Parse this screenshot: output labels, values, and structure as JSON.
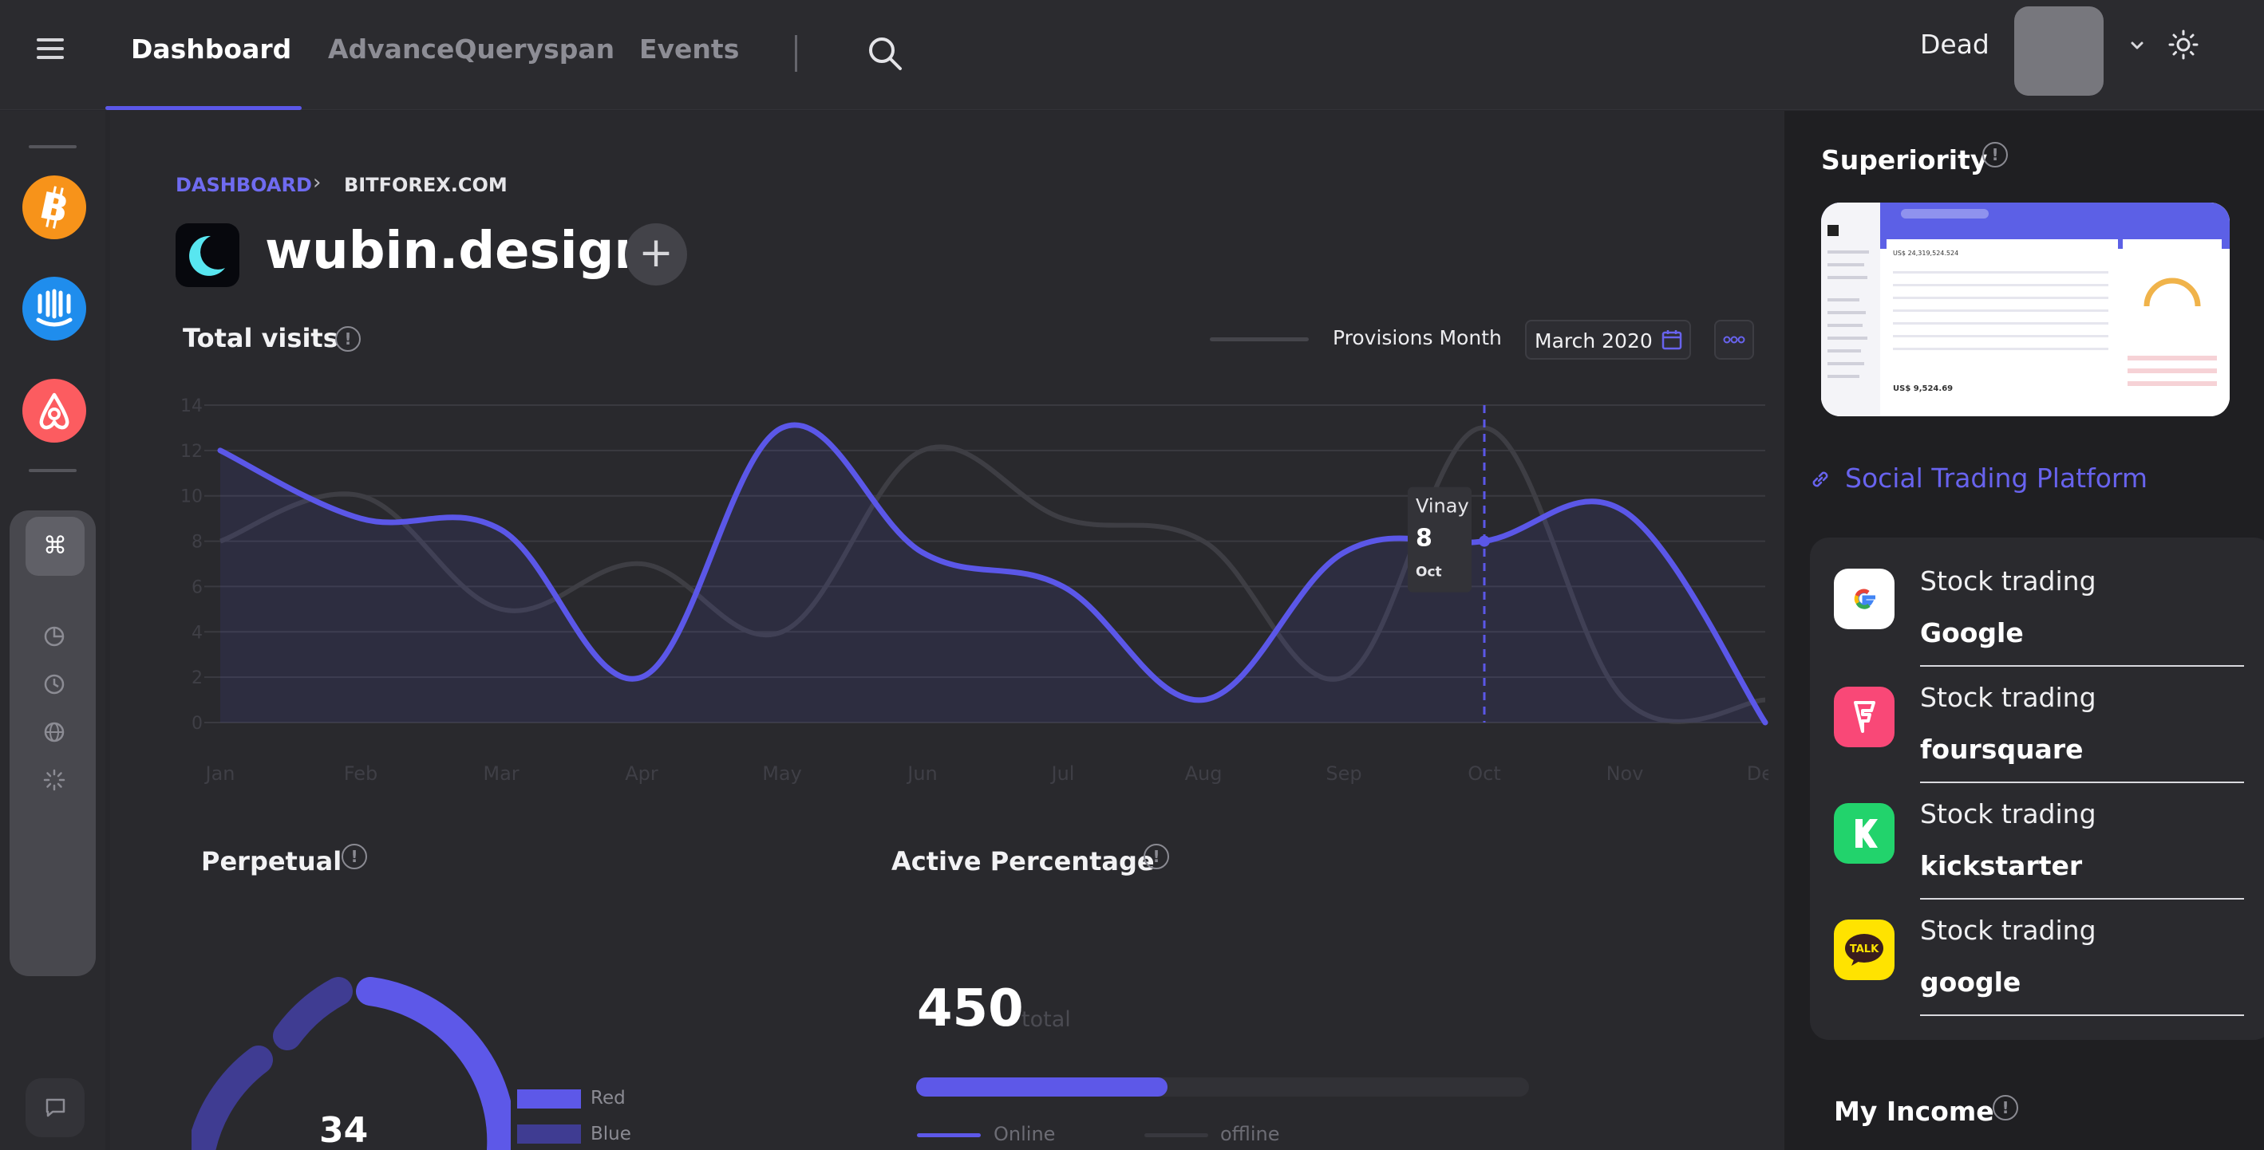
{
  "nav": {
    "tabs": [
      "Dashboard",
      "AdvanceQueryspan",
      "Events"
    ],
    "active_tab": "Dashboard",
    "user_name": "Dead"
  },
  "breadcrumb": [
    "DASHBOARD",
    "BITFOREX.COM"
  ],
  "site": {
    "title": "wubin.design",
    "add_symbol": "+"
  },
  "visits": {
    "title": "Total visits",
    "info_symbol": "!",
    "legend_label": "Provisions Month",
    "date_value": "March 2020",
    "tooltip": {
      "name": "Vinay",
      "value": "8",
      "month": "Oct"
    }
  },
  "chart_data": {
    "type": "line",
    "categories": [
      "Jan",
      "Feb",
      "Mar",
      "Apr",
      "May",
      "Jun",
      "Jul",
      "Aug",
      "Sep",
      "Oct",
      "Nov",
      "Dec"
    ],
    "ylim": [
      0,
      14
    ],
    "yticks": [
      0,
      2,
      4,
      6,
      8,
      10,
      12,
      14
    ],
    "grid": true,
    "series": [
      {
        "name": "Vinay",
        "color": "#5b57e8",
        "values": [
          12,
          9,
          8.5,
          2,
          13,
          7.5,
          6,
          1,
          7.5,
          8,
          9.3,
          0
        ]
      },
      {
        "color": "#3e3e44",
        "values": [
          8,
          10,
          5,
          7,
          4,
          12,
          9,
          8,
          2,
          13,
          1,
          1
        ]
      }
    ]
  },
  "perpetual": {
    "title": "Perpetual",
    "center_value": "34",
    "legend": [
      {
        "label": "Red",
        "color": "#5d58e8"
      },
      {
        "label": "Blue",
        "color": "#3f3c92"
      }
    ]
  },
  "active_percentage": {
    "title": "Active Percentage",
    "total": "450",
    "total_label": "total",
    "online_fraction": 0.41,
    "online_label": "Online",
    "offline_label": "offline"
  },
  "superiority": {
    "title": "Superiority",
    "link_text": "Social Trading Platform"
  },
  "stocks": [
    {
      "title": "Stock trading",
      "name": "Google",
      "icon": "google-logo-icon",
      "bg": "#ffffff"
    },
    {
      "title": "Stock trading",
      "name": "foursquare",
      "icon": "foursquare-logo-icon",
      "bg": "#f94877"
    },
    {
      "title": "Stock trading",
      "name": "kickstarter",
      "icon": "kickstarter-logo-icon",
      "bg": "#22d36c"
    },
    {
      "title": "Stock trading",
      "name": "google",
      "icon": "kakaotalk-logo-icon",
      "bg": "#ffe300"
    }
  ],
  "kakao_badge": "TALK",
  "income": {
    "title": "My Income"
  },
  "sidebar_apps": [
    "bitcoin-icon",
    "intercom-icon",
    "airbnb-icon"
  ],
  "cmd_symbol": "⌘"
}
